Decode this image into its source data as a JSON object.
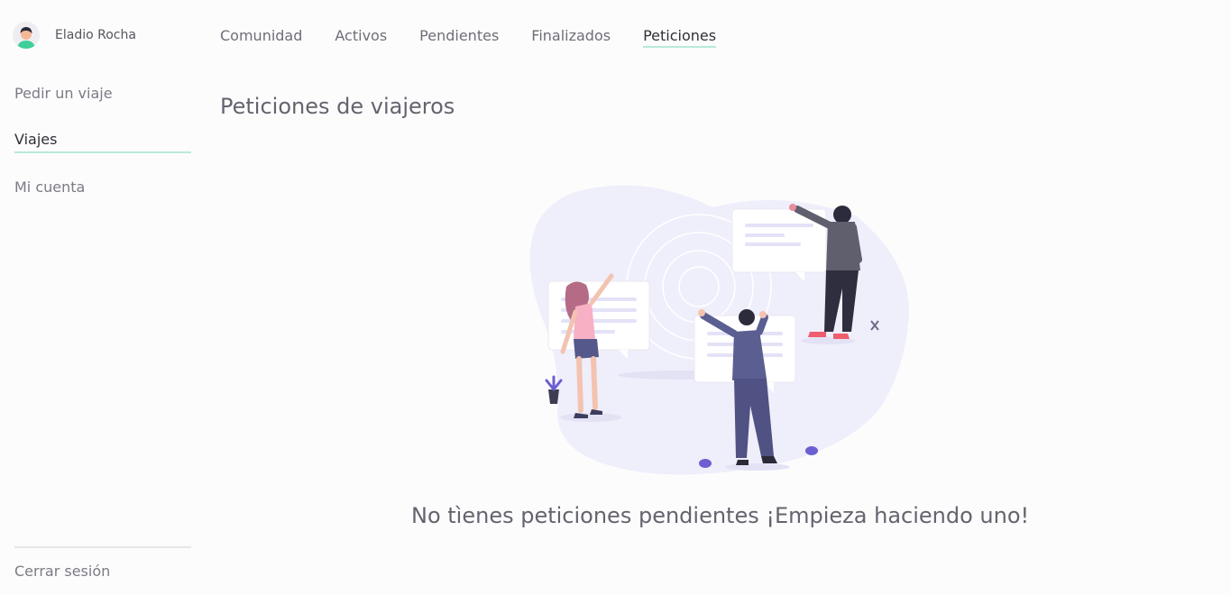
{
  "user": {
    "name": "Eladio Rocha",
    "avatar_icon": "user-avatar-icon"
  },
  "sidebar": {
    "items": [
      {
        "label": "Pedir un viaje"
      },
      {
        "label": "Viajes"
      },
      {
        "label": "Mi cuenta"
      }
    ],
    "logout": "Cerrar sesión"
  },
  "tabs": [
    {
      "label": "Comunidad"
    },
    {
      "label": "Activos"
    },
    {
      "label": "Pendientes"
    },
    {
      "label": "Finalizados"
    },
    {
      "label": "Peticiones"
    }
  ],
  "main": {
    "title": "Peticiones de viajeros",
    "empty_message": "No tìenes peticiones pendientes ¡Empieza haciendo uno!",
    "illustration_icon": "people-chat-illustration"
  },
  "colors": {
    "accent": "#b8ead8",
    "blob": "#efeefb",
    "illustration_purple": "#5a5d8c"
  }
}
